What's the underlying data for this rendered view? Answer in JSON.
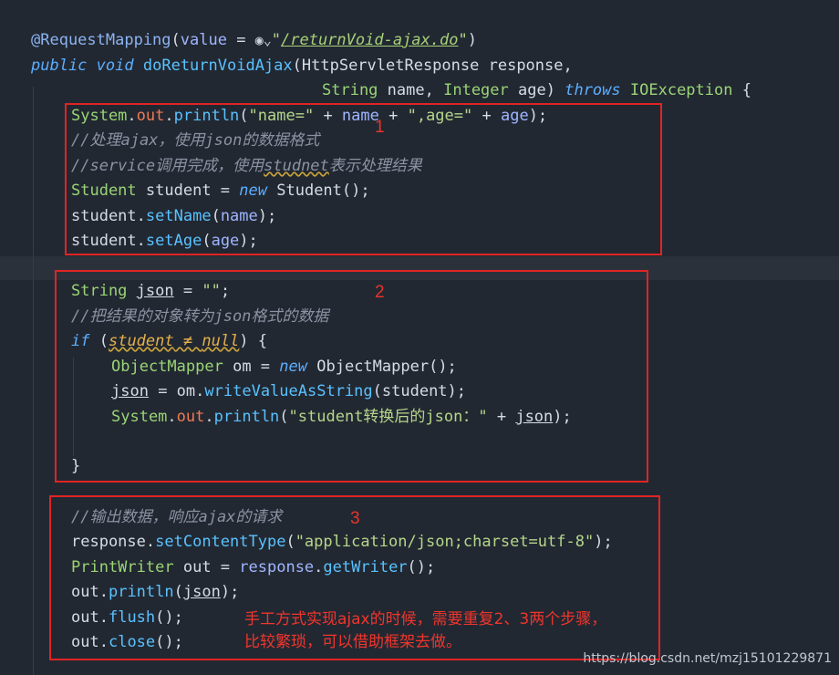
{
  "code": {
    "annotation": "@RequestMapping",
    "ann_param": "value",
    "url": "/returnVoid-ajax.do",
    "kw_public": "public",
    "kw_void": "void",
    "method_name": "doReturnVoidAjax",
    "type_response": "HttpServletResponse",
    "param_response": "response",
    "type_string": "String",
    "param_name": "name",
    "type_integer": "Integer",
    "param_age": "age",
    "kw_throws": "throws",
    "exception": "IOException",
    "str_name": "\"name=\"",
    "str_age": "\",age=\"",
    "comment1": "//处理ajax，使用json的数据格式",
    "comment2_a": "//service调用完成，使用",
    "comment2_b": "studnet",
    "comment2_c": "表示处理结果",
    "type_student": "Student",
    "var_student": "student",
    "kw_new": "new",
    "fn_setName": "setName",
    "fn_setAge": "setAge",
    "var_json": "json",
    "str_empty": "\"\"",
    "comment3": "//把结果的对象转为json格式的数据",
    "kw_if": "if",
    "kw_null": "null",
    "type_mapper": "ObjectMapper",
    "var_om": "om",
    "fn_write": "writeValueAsString",
    "str_converted": "\"student转换后的json：\"",
    "comment4": "//输出数据，响应ajax的请求",
    "fn_setContentType": "setContentType",
    "str_content_type": "\"application/json;charset=utf-8\"",
    "type_writer": "PrintWriter",
    "var_out": "out",
    "fn_getWriter": "getWriter",
    "fn_println": "println",
    "fn_flush": "flush",
    "fn_close": "close",
    "system": "System",
    "field_out": "out"
  },
  "annotations": {
    "label1": "1",
    "label2": "2",
    "label3": "3",
    "note_line1": "手工方式实现ajax的时候，需要重复2、3两个步骤，",
    "note_line2": "比较繁琐，可以借助框架去做。"
  },
  "watermark": "https://blog.csdn.net/mzj15101229871",
  "colors": {
    "background": "#222832",
    "annotation_red": "#e02424"
  }
}
